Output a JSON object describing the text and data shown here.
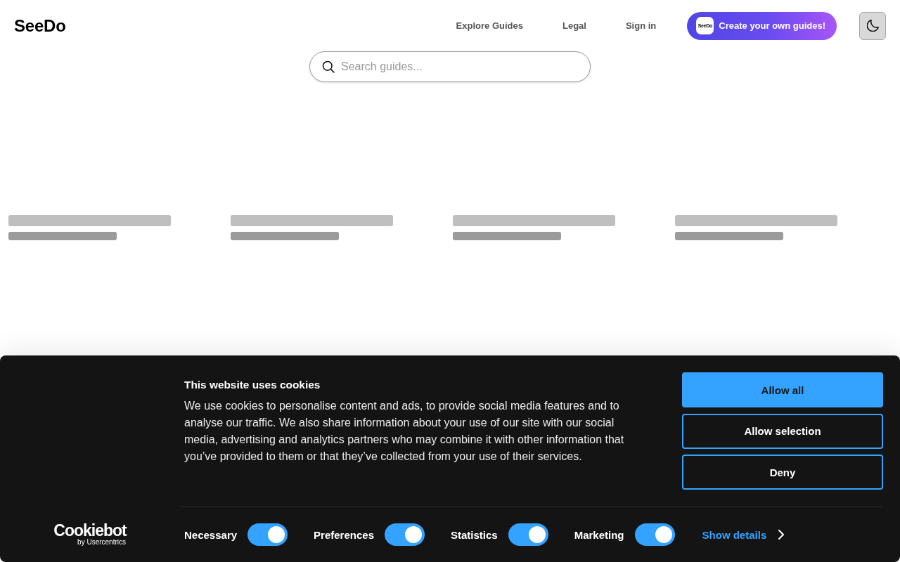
{
  "header": {
    "logo": "SeeDo",
    "nav": [
      {
        "label": "Explore Guides"
      },
      {
        "label": "Legal"
      },
      {
        "label": "Sign in"
      }
    ],
    "cta": {
      "badge": "SeeDo",
      "label": "Create your own guides!"
    }
  },
  "search": {
    "placeholder": "Search guides..."
  },
  "guide_cards": [
    {
      "loading": true
    },
    {
      "loading": true
    },
    {
      "loading": true
    },
    {
      "loading": true
    }
  ],
  "cookie_banner": {
    "title": "This website uses cookies",
    "body": "We use cookies to personalise content and ads, to provide social media features and to analyse our traffic. We also share information about your use of our site with our social media, advertising and analytics partners who may combine it with other information that you’ve provided to them or that they’ve collected from your use of their services.",
    "buttons": [
      {
        "label": "Allow all",
        "kind": "primary"
      },
      {
        "label": "Allow selection",
        "kind": "outline"
      },
      {
        "label": "Deny",
        "kind": "outline"
      }
    ],
    "toggles": [
      {
        "label": "Necessary",
        "on": true
      },
      {
        "label": "Preferences",
        "on": true
      },
      {
        "label": "Statistics",
        "on": true
      },
      {
        "label": "Marketing",
        "on": true
      }
    ],
    "details_link": "Show details",
    "brand": {
      "name": "Cookiebot",
      "byline": "by Usercentrics"
    }
  }
}
